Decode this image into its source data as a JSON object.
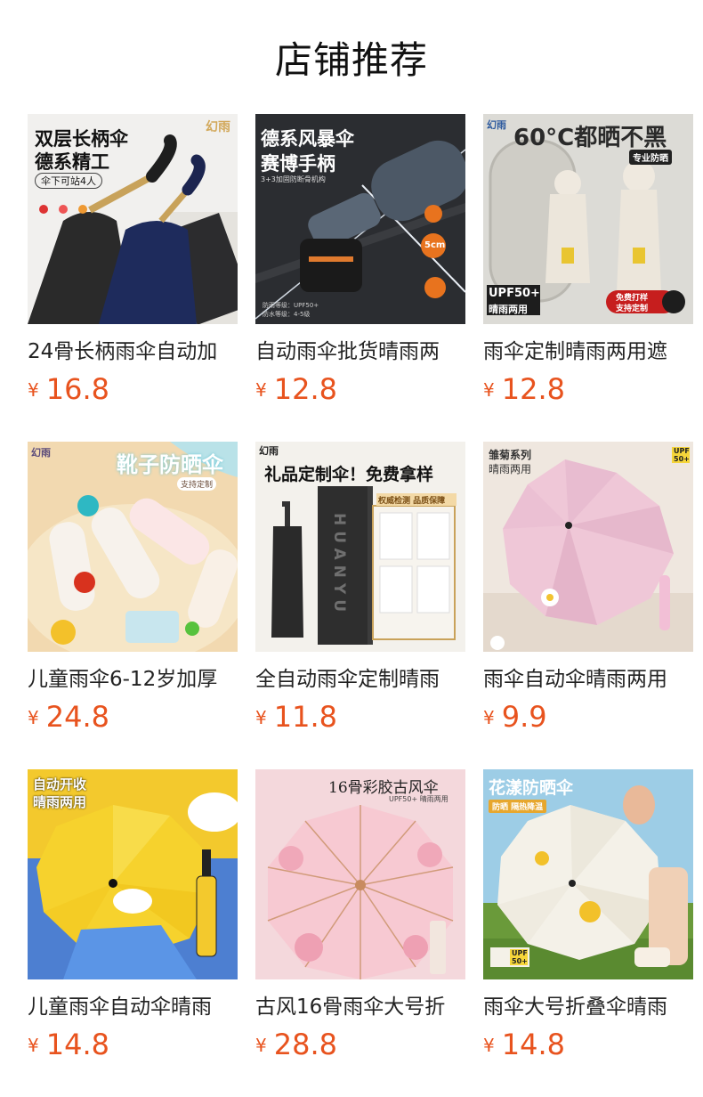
{
  "page": {
    "title": "店铺推荐"
  },
  "currency": "¥",
  "products": [
    {
      "name": "24骨长柄雨伞自动加",
      "price": "16.8",
      "img": {
        "brand": "幻雨",
        "line1": "双层长柄伞",
        "line2": "德系精工",
        "tag": "伞下可站4人"
      }
    },
    {
      "name": "自动雨伞批货晴雨两",
      "price": "12.8",
      "img": {
        "line1": "德系风暴伞",
        "line2": "赛博手柄",
        "sub": "3+3加固防断骨机构",
        "badge": "5cm",
        "spec1": "防雨等级：UPF50+",
        "spec2": "防水等级：4-5级"
      }
    },
    {
      "name": "雨伞定制晴雨两用遮",
      "price": "12.8",
      "img": {
        "brand": "幻雨",
        "headline": "60°C都晒不黑",
        "badge": "专业防晒",
        "upf": "UPF50+",
        "upf_sub": "晴雨两用",
        "promo1": "免费打样",
        "promo2": "支持定制"
      }
    },
    {
      "name": "儿童雨伞6-12岁加厚",
      "price": "24.8",
      "img": {
        "brand": "幻雨",
        "headline": "靴子防晒伞",
        "sub": "支持定制"
      }
    },
    {
      "name": "全自动雨伞定制晴雨",
      "price": "11.8",
      "img": {
        "brand": "幻雨",
        "headline": "礼品定制伞！免费拿样",
        "badge": "权威检测 品质保障",
        "box_text": "HUANYU"
      }
    },
    {
      "name": "雨伞自动伞晴雨两用",
      "price": "9.9",
      "img": {
        "line1": "雏菊系列",
        "line2": "晴雨两用",
        "upf": "UPF 50+"
      }
    },
    {
      "name": "儿童雨伞自动伞晴雨",
      "price": "14.8",
      "img": {
        "line1": "自动开收",
        "line2": "晴雨两用"
      }
    },
    {
      "name": "古风16骨雨伞大号折",
      "price": "28.8",
      "img": {
        "headline": "16骨彩胶古风伞",
        "sub": "UPF50+ 晴雨两用"
      }
    },
    {
      "name": "雨伞大号折叠伞晴雨",
      "price": "14.8",
      "img": {
        "headline": "花漾防晒伞",
        "sub": "防晒 隔热降温",
        "upf": "UPF 50+"
      }
    }
  ],
  "colors": {
    "price": "#e8531e",
    "title": "#111111",
    "name": "#222222"
  }
}
